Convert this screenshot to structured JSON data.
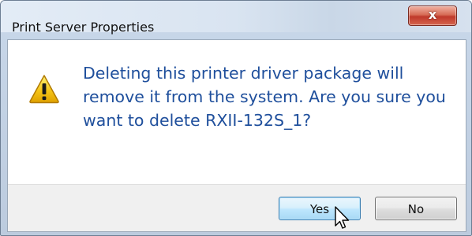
{
  "window": {
    "title": "Print Server Properties",
    "close_glyph": "x"
  },
  "dialog": {
    "icon": "warning-icon",
    "message": "Deleting this printer driver package will remove it from the system. Are you sure you want to delete RXII-132S_1?"
  },
  "buttons": {
    "yes_label": "Yes",
    "no_label": "No"
  },
  "cursor": {
    "icon": "pointer-cursor-icon"
  },
  "colors": {
    "message_text": "#1f4f9c",
    "close_button": "#c0392b",
    "default_button_border": "#3c7fb1",
    "warning_fill": "#f5c518"
  }
}
